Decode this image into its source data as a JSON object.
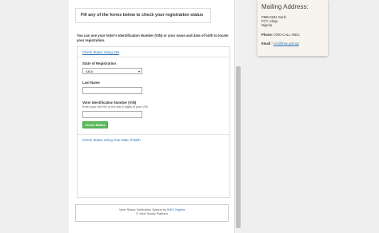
{
  "header": {
    "title": "Fill any of the forms below to check your registration status"
  },
  "intro": "You can use your Voter's Identification Number (VIN) or your name and date of birth to locate your registration.",
  "panel": {
    "vin_link": "Check Status Using VIN",
    "state_label": "State of Registration",
    "state_value": "ABIA",
    "last_name_label": "Last Name",
    "last_name_value": "",
    "vin_label": "Voter Identification Number (VIN)",
    "vin_hint": "Enter your full VIN or the last 5 digits of your VIN",
    "vin_value": "",
    "check_button": "Check Status",
    "dob_link": "Check Status Using Your Date of Birth"
  },
  "footer": {
    "line1_pre": "Voter Status Verification System by",
    "line1_link": "INEC Nigeria",
    "line2": "© Voter Status Platform"
  },
  "mailing": {
    "title": "Mailing Address:",
    "line1": "PMB 0184 Garki",
    "line2": "FCT, Abuja",
    "line3": "Nigeria",
    "phone_label": "Phone:",
    "phone_value": "0700-CALL-INEC",
    "email_label": "Email :",
    "email_value": "ccc@inec.gov.ng"
  },
  "colors": {
    "link": "#2a6fb3",
    "button": "#5cb85c",
    "card_bg": "#f7f4ee"
  }
}
